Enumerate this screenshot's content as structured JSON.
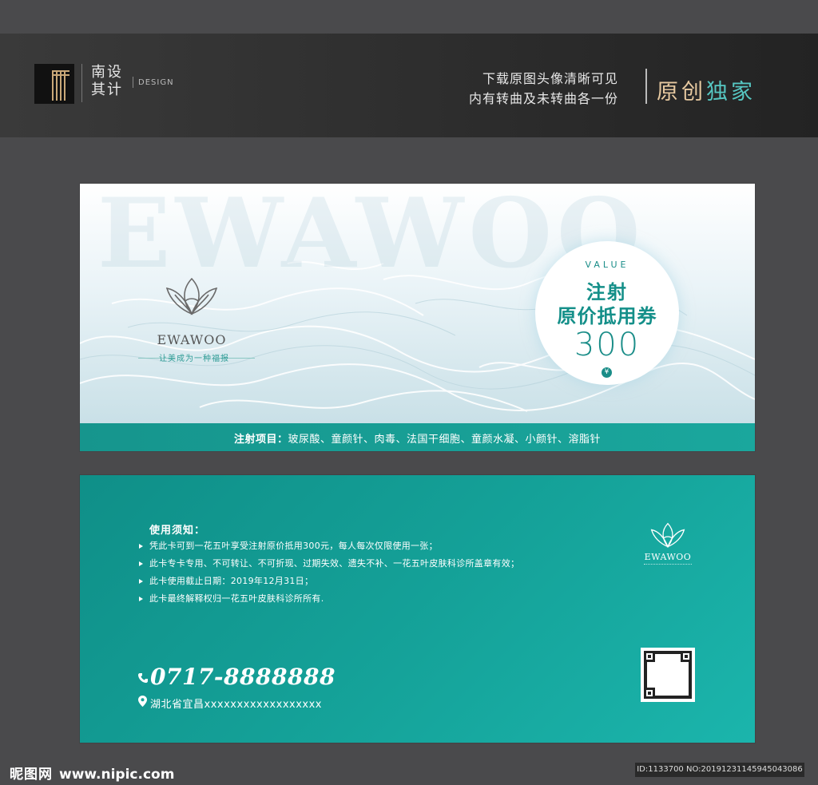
{
  "header": {
    "logo_cn_line1": "南设",
    "logo_cn_line2": "其计",
    "logo_en": "DESIGN",
    "line1": "下载原图头像清晰可见",
    "line2": "内有转曲及未转曲各一份",
    "badge_part1": "原创",
    "badge_part2": "独家",
    "colors": {
      "badge_gold": "#e7c9a0",
      "badge_teal": "#56c7c2"
    }
  },
  "front": {
    "watermark": "EWAWOO",
    "brand_name": "EWAWOO",
    "brand_slogan": "让美成为一种福报",
    "value_label": "VALUE",
    "title_line1": "注射",
    "title_line2": "原价抵用券",
    "amount": "300",
    "currency": "¥",
    "band_label": "注射项目：",
    "band_items": "玻尿酸、童颜针、肉毒、法国干细胞、童颜水凝、小颜针、溶脂针",
    "colors": {
      "accent": "#1a8d88",
      "band": "#16958d"
    }
  },
  "back": {
    "notice_title": "使用须知：",
    "notices": [
      "凭此卡可到一花五叶享受注射原价抵用300元，每人每次仅限使用一张；",
      "此卡专卡专用、不可转让、不可折现、过期失效、遗失不补、一花五叶皮肤科诊所盖章有效；",
      "此卡使用截止日期：2019年12月31日；",
      "此卡最终解释权归一花五叶皮肤科诊所所有."
    ],
    "brand_name": "EWAWOO",
    "phone": "0717-8888888",
    "address": "湖北省宜昌xxxxxxxxxxxxxxxxxx",
    "colors": {
      "background": "#15a39a"
    }
  },
  "footer": {
    "site_cn": "昵图网",
    "site_url": "www.nipic.com",
    "id_text": "ID:1133700 NO:20191231145945043086"
  }
}
